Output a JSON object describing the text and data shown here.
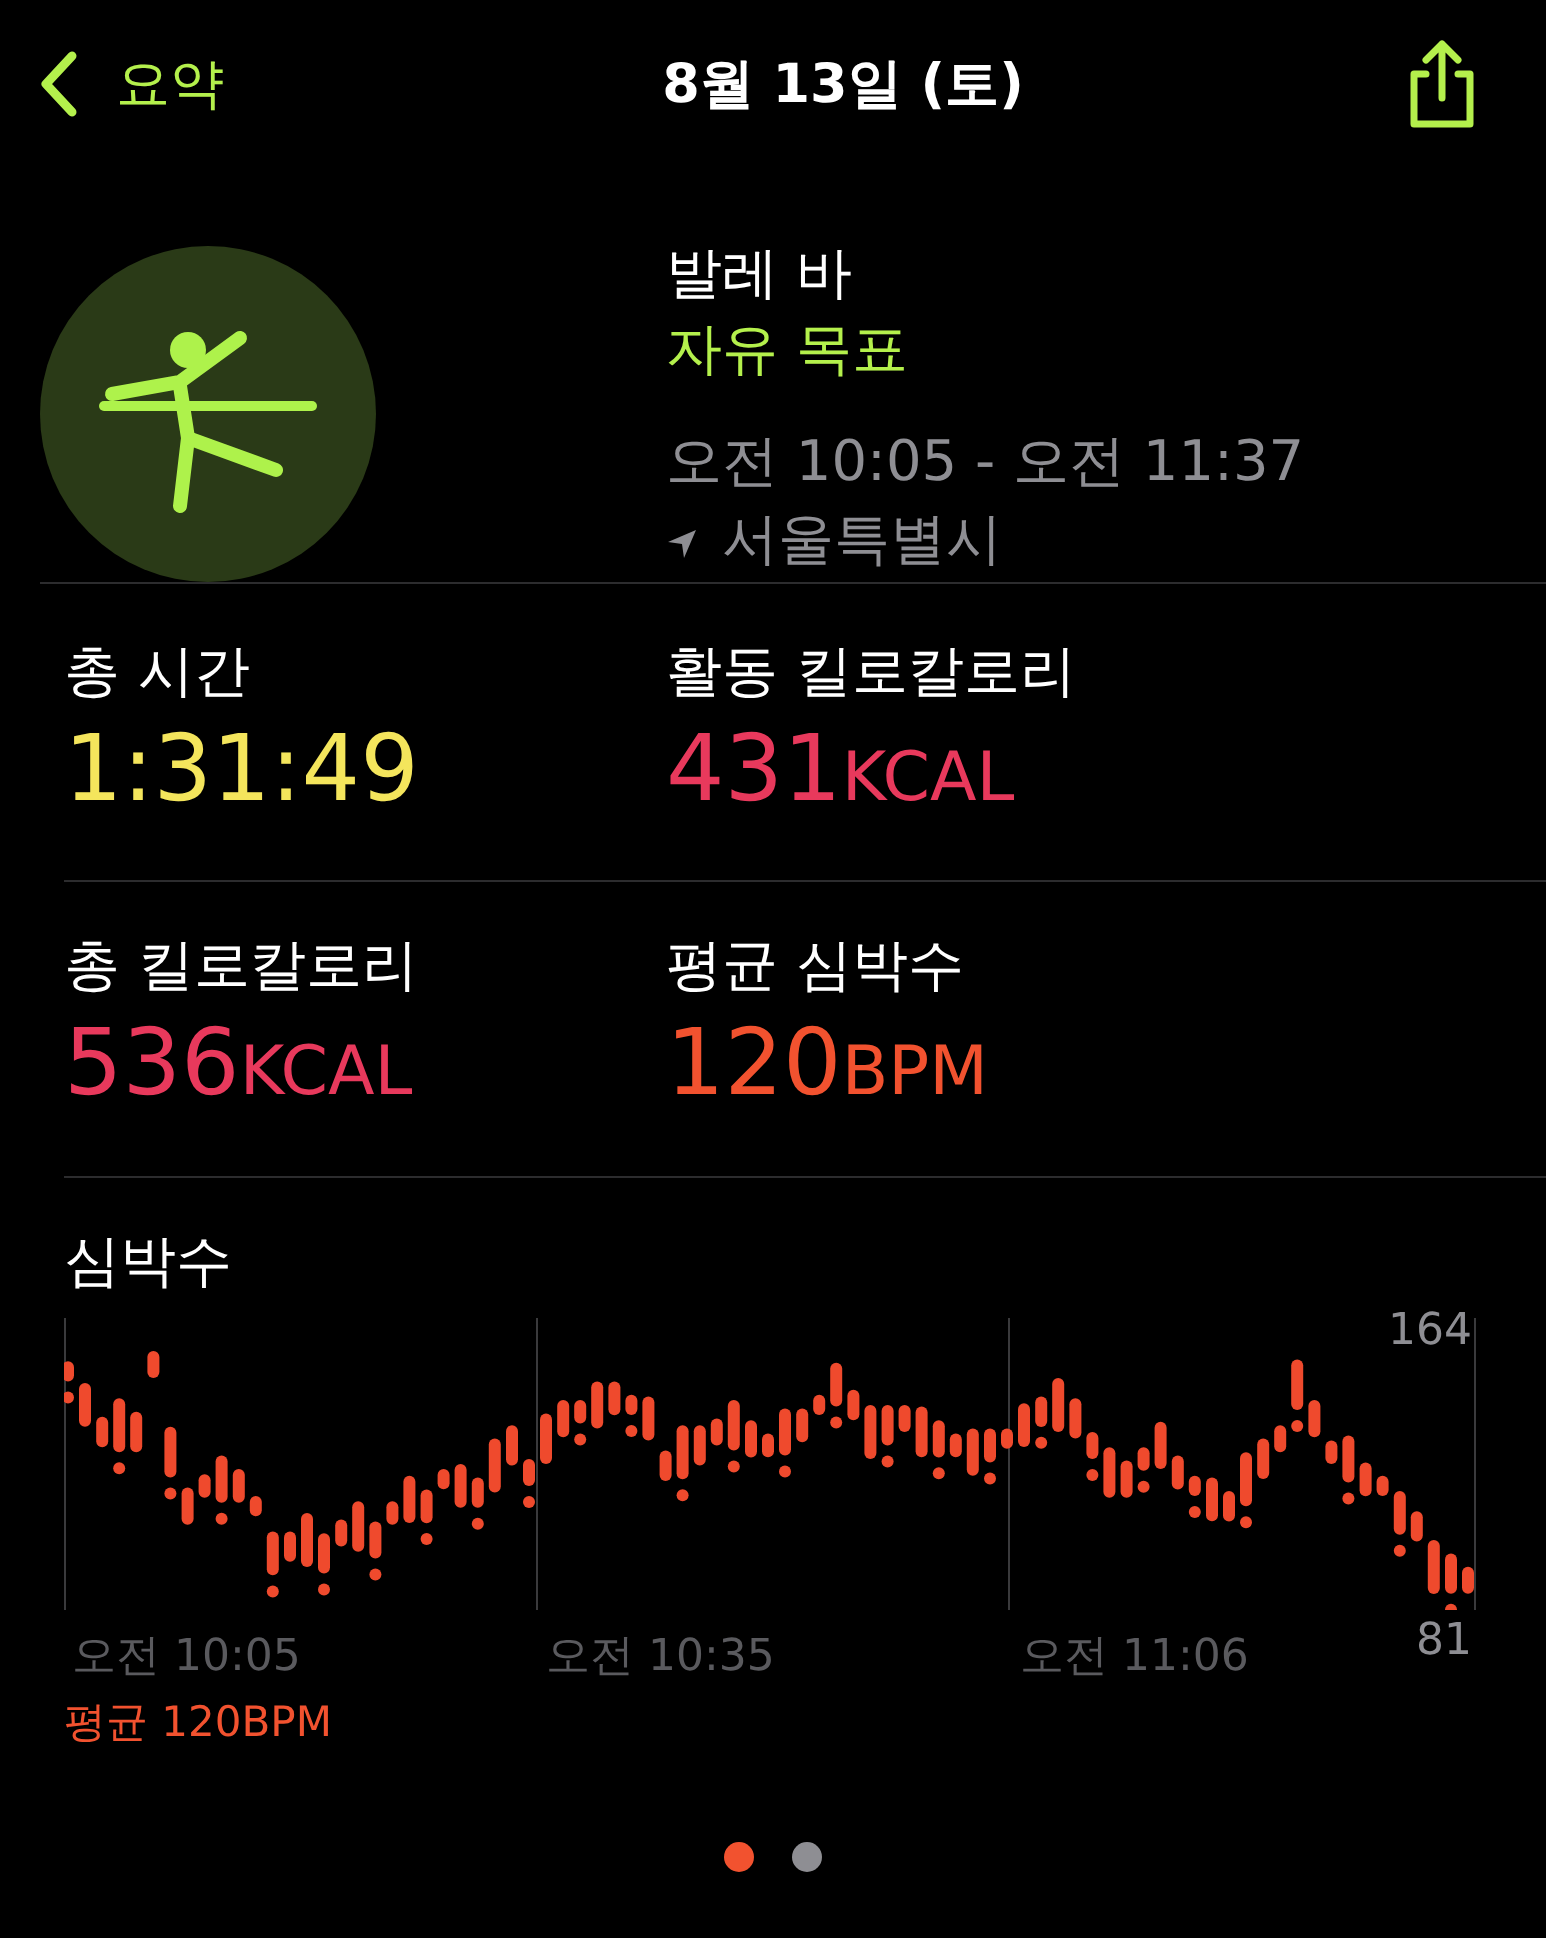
{
  "nav": {
    "back_label": "요약",
    "title": "8월 13일 (토)"
  },
  "workout": {
    "name": "발레 바",
    "goal": "자유 목표",
    "time_range": "오전 10:05 - 오전 11:37",
    "location": "서울특별시"
  },
  "stats": [
    {
      "label": "총 시간",
      "value": "1:31:49",
      "color": "#f4e55c"
    },
    {
      "label": "활동 킬로칼로리",
      "value": "431",
      "unit": "KCAL",
      "color": "#e8395c"
    },
    {
      "label": "총 킬로칼로리",
      "value": "536",
      "unit": "KCAL",
      "color": "#e8395c"
    },
    {
      "label": "평균 심박수",
      "value": "120",
      "unit": "BPM",
      "color": "#f2522f"
    }
  ],
  "heart_rate": {
    "title": "심박수",
    "y_max_label": "164",
    "y_min_label": "81",
    "time_labels": [
      "오전 10:05",
      "오전 10:35",
      "오전 11:06"
    ],
    "average": "평균 120BPM"
  },
  "pages": [
    {
      "selected": true
    },
    {
      "selected": false
    }
  ]
}
